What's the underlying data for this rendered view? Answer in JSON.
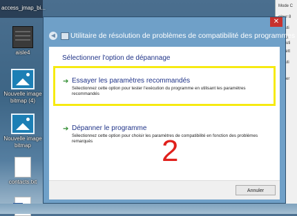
{
  "desktop": {
    "top_label": "access_jmap_bi...",
    "icons": [
      {
        "label": "aisle4"
      },
      {
        "label": "Nouvelle image bitmap (4)"
      },
      {
        "label": "Nouvelle image bitmap"
      },
      {
        "label": "contacts.txt"
      },
      {
        "label": ""
      }
    ]
  },
  "background_window": {
    "lines": [
      "Mode C",
      "eleur 8",
      "xécuti",
      "ésact",
      "ésoluti",
      "ermett",
      "xécuti",
      "odifier"
    ]
  },
  "dialog": {
    "title": "Utilitaire de résolution de problèmes de compatibilité des programmes",
    "close_label": "✕",
    "header": "Sélectionner l'option de dépannage",
    "options": [
      {
        "title": "Essayer les paramètres recommandés",
        "description": "Sélectionnez cette option pour tester l'exécution du programme en utilisant les paramètres recommandés"
      },
      {
        "title": "Dépanner le programme",
        "description": "Sélectionnez cette option pour choisir les paramètres de compatibilité en fonction des problèmes remarqués"
      }
    ],
    "cancel_label": "Annuler"
  },
  "annotation": {
    "number": "2",
    "highlight_color": "#f6ea10",
    "number_color": "#e0201c"
  }
}
